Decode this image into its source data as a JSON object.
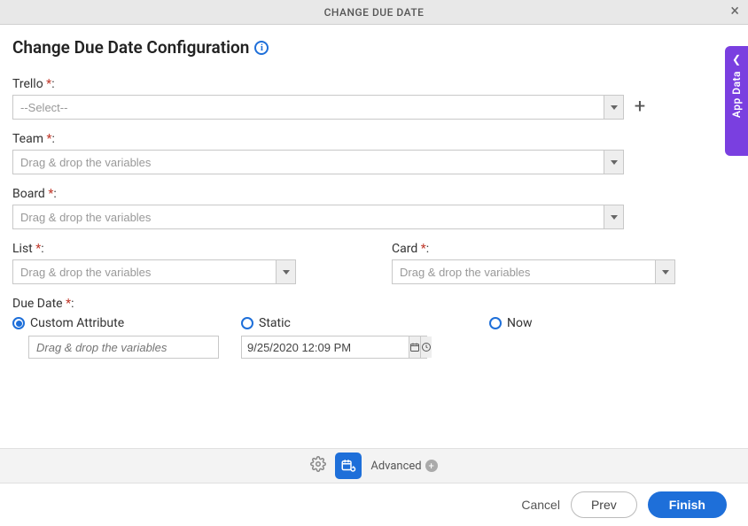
{
  "titlebar": {
    "title": "CHANGE DUE DATE"
  },
  "heading": "Change Due Date Configuration",
  "fields": {
    "trello": {
      "label": "Trello",
      "placeholder": "--Select--"
    },
    "team": {
      "label": "Team",
      "placeholder": "Drag & drop the variables"
    },
    "board": {
      "label": "Board",
      "placeholder": "Drag & drop the variables"
    },
    "list": {
      "label": "List",
      "placeholder": "Drag & drop the variables"
    },
    "card": {
      "label": "Card",
      "placeholder": "Drag & drop the variables"
    },
    "dueDate": {
      "label": "Due Date",
      "options": {
        "custom": {
          "label": "Custom Attribute",
          "placeholder": "Drag & drop the variables"
        },
        "static": {
          "label": "Static",
          "value": "9/25/2020 12:09 PM"
        },
        "now": {
          "label": "Now"
        }
      },
      "selected": "custom"
    }
  },
  "toolbar": {
    "advanced_label": "Advanced"
  },
  "footer": {
    "cancel": "Cancel",
    "prev": "Prev",
    "finish": "Finish"
  },
  "sideTab": {
    "label": "App Data"
  }
}
